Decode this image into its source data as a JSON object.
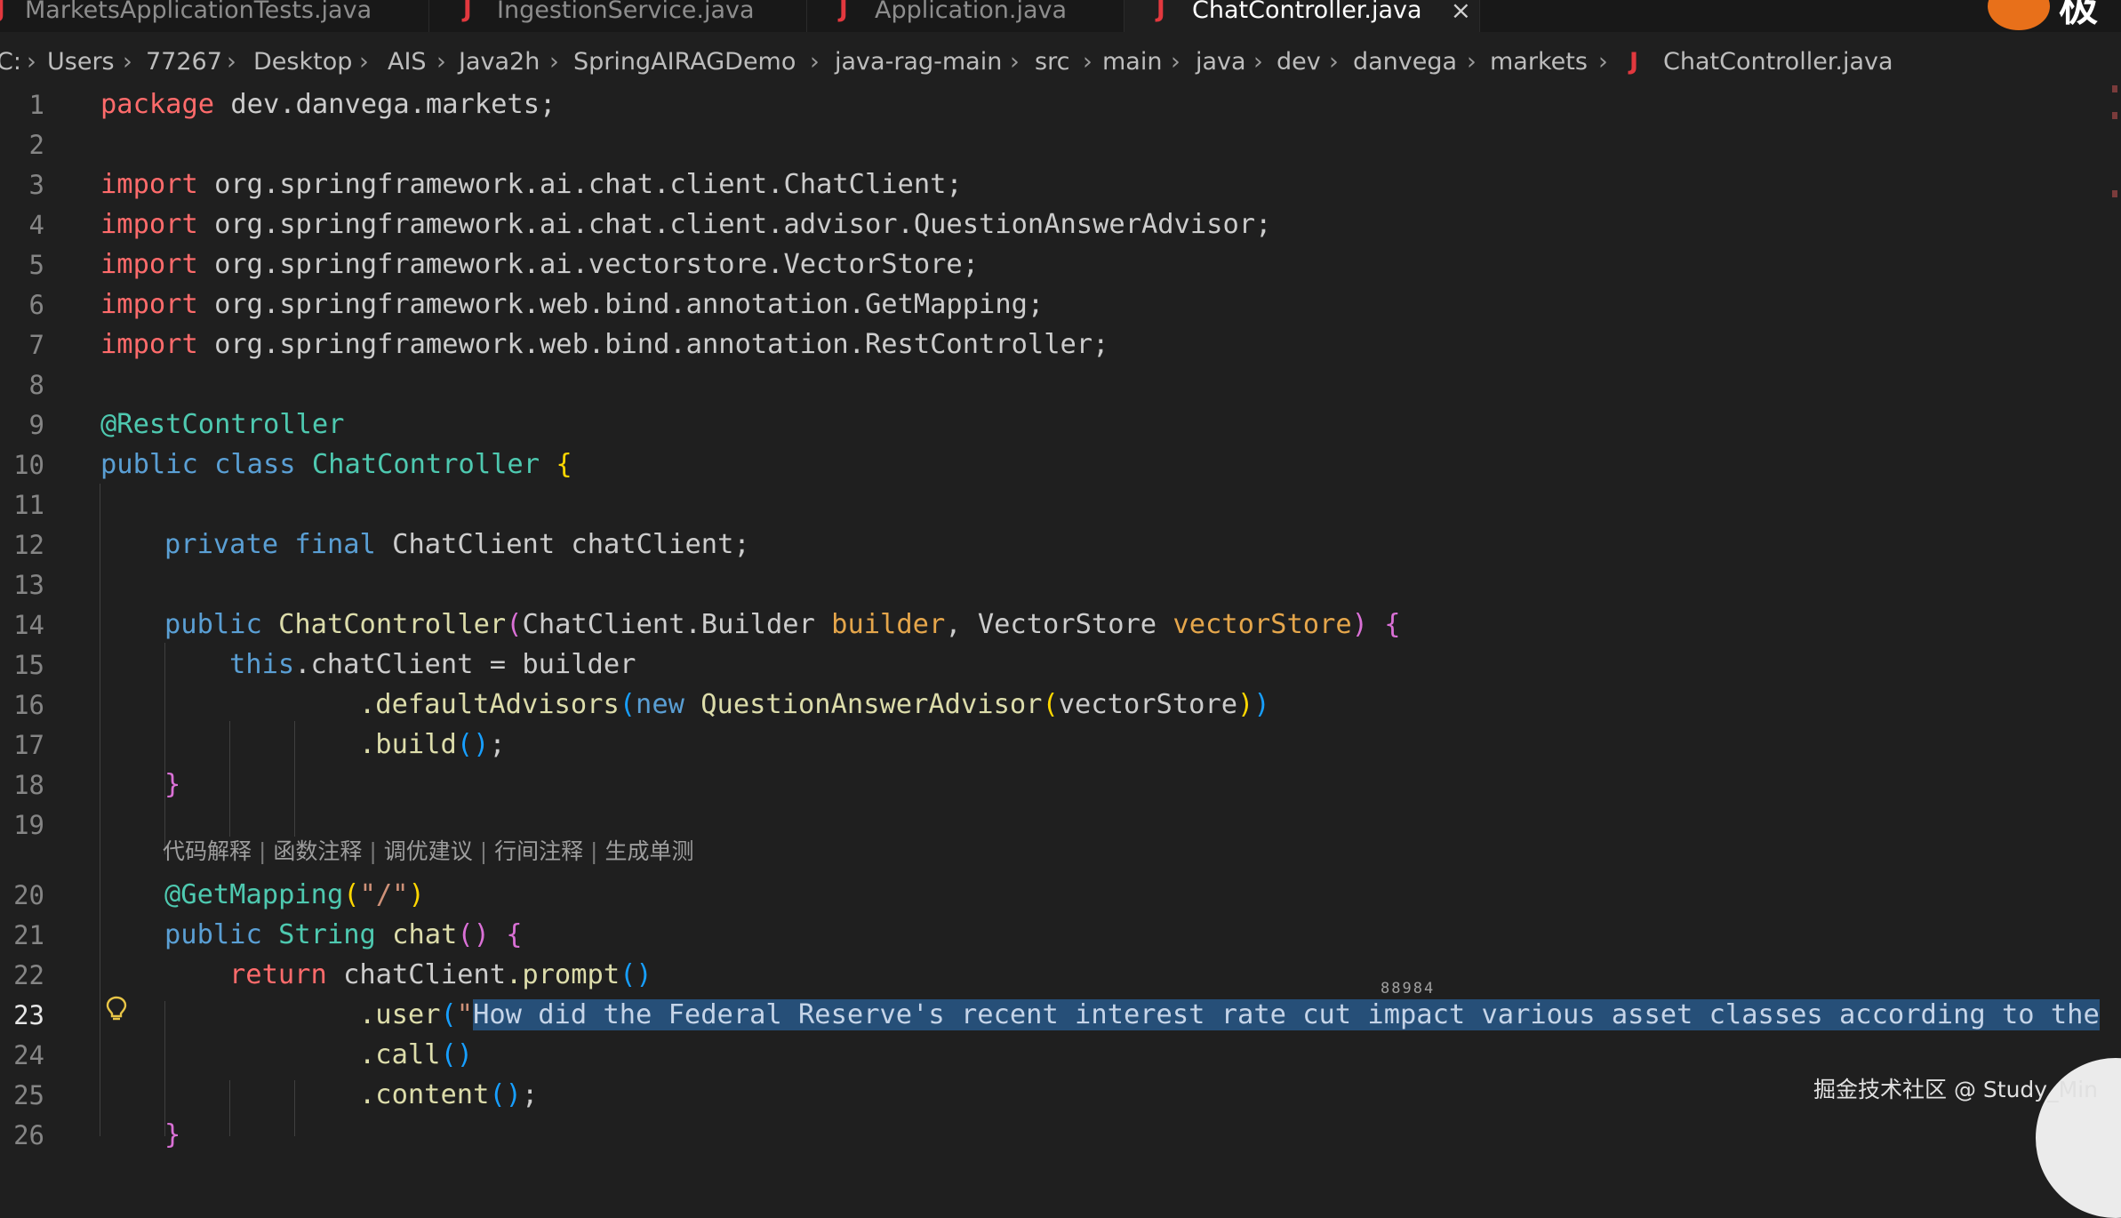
{
  "tabs": [
    {
      "label": "MarketsApplicationTests.java",
      "active": false
    },
    {
      "label": "IngestionService.java",
      "active": false
    },
    {
      "label": "Application.java",
      "active": false
    },
    {
      "label": "ChatController.java",
      "active": true,
      "close_glyph": "×"
    }
  ],
  "tab_file_icon": "J",
  "corner_glyph": "极",
  "breadcrumb": [
    "C:",
    "Users",
    "77267",
    "Desktop",
    "AIS",
    "Java2h",
    "SpringAIRAGDemo",
    "java-rag-main",
    "src",
    "main",
    "java",
    "dev",
    "danvega",
    "markets",
    "ChatController.java"
  ],
  "breadcrumb_separator": "›",
  "line_numbers": [
    "1",
    "2",
    "3",
    "4",
    "5",
    "6",
    "7",
    "8",
    "9",
    "10",
    "11",
    "12",
    "13",
    "14",
    "15",
    "16",
    "17",
    "18",
    "19",
    "20",
    "21",
    "22",
    "23",
    "24",
    "25",
    "26"
  ],
  "code": {
    "l1": {
      "kw": "package",
      "rest": " dev.danvega.markets;"
    },
    "l3": {
      "kw": "import",
      "rest": " org.springframework.ai.chat.client.ChatClient;"
    },
    "l4": {
      "kw": "import",
      "rest": " org.springframework.ai.chat.client.advisor.QuestionAnswerAdvisor;"
    },
    "l5": {
      "kw": "import",
      "rest": " org.springframework.ai.vectorstore.VectorStore;"
    },
    "l6": {
      "kw": "import",
      "rest": " org.springframework.web.bind.annotation.GetMapping;"
    },
    "l7": {
      "kw": "import",
      "rest": " org.springframework.web.bind.annotation.RestController;"
    },
    "l9": {
      "ann": "@RestController"
    },
    "l10": {
      "kw1": "public",
      "kw2": "class",
      "name": "ChatController",
      "brace": "{"
    },
    "l12": {
      "kw1": "private",
      "kw2": "final",
      "rest": "ChatClient chatClient;"
    },
    "l14": {
      "kw": "public",
      "fn": "ChatController",
      "open": "(",
      "t1": "ChatClient.Builder",
      "p1": "builder",
      "comma": ",",
      "t2": "VectorStore",
      "p2": "vectorStore",
      "close": ")",
      "brace": "{"
    },
    "l15": {
      "kw": "this",
      "rest": ".chatClient = builder"
    },
    "l16": {
      "fn": ".defaultAdvisors",
      "open": "(",
      "kw": "new",
      "type": "QuestionAnswerAdvisor",
      "open2": "(",
      "arg": "vectorStore",
      "close2": ")",
      "close": ")"
    },
    "l17": {
      "fn": ".build",
      "parens": "()",
      "semi": ";"
    },
    "l18": {
      "brace": "}"
    },
    "l20": {
      "ann": "@GetMapping",
      "open": "(",
      "str": "\"/\"",
      "close": ")"
    },
    "l21": {
      "kw": "public",
      "type": "String",
      "fn": "chat",
      "parens": "()",
      "brace": "{"
    },
    "l22": {
      "kw": "return",
      "obj": "chatClient",
      "fn": ".prompt",
      "parens": "()"
    },
    "l23": {
      "fn": ".user",
      "open": "(",
      "quote": "\"",
      "selected": "How did the Federal Reserve's recent interest rate cut impact various asset classes according to the"
    },
    "l24": {
      "fn": ".call",
      "parens": "()"
    },
    "l25": {
      "fn": ".content",
      "parens": "()",
      "semi": ";"
    },
    "l26": {
      "brace": "}"
    }
  },
  "codelens": [
    "代码解释",
    "函数注释",
    "调优建议",
    "行间注释",
    "生成单测"
  ],
  "codelens_separator": "|",
  "inline_hint": "88984",
  "watermark": "掘金技术社区 @ Study_Min",
  "colors": {
    "editor_bg": "#1f1f1f",
    "keyword_red": "#ff6b6b",
    "keyword_blue": "#5a9fd4",
    "type": "#4ec9b0",
    "function": "#dcdcaa",
    "parameter": "#e5a64b",
    "selection": "#264f78",
    "java_icon": "#e2383e"
  },
  "icons": [
    "java-file-icon",
    "close-icon",
    "chevron-right-icon",
    "lightbulb-icon",
    "brand-logo"
  ]
}
